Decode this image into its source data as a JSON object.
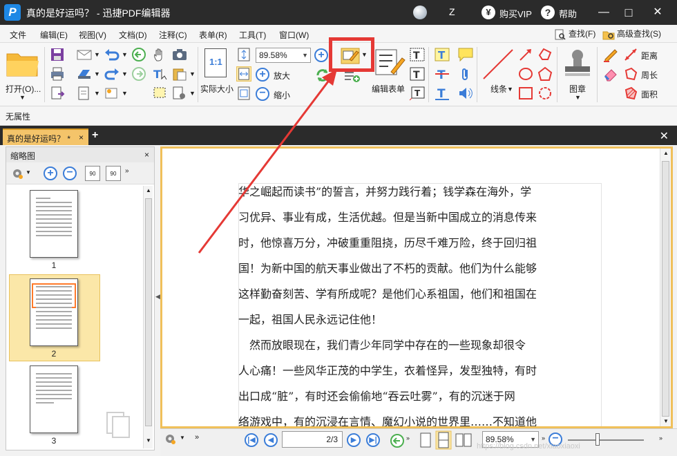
{
  "app": {
    "title": "真的是好运吗？ - 迅捷PDF编辑器",
    "logo_letter": "P",
    "user_label": "Z",
    "vip_icon": "yen-icon",
    "vip_label": "购买VIP",
    "help_label": "帮助",
    "minimize": "—",
    "maximize": "□",
    "close": "✕"
  },
  "menu": {
    "items": [
      "文件",
      "编辑(E)",
      "视图(V)",
      "文档(D)",
      "注释(C)",
      "表单(R)",
      "工具(T)",
      "窗口(W)"
    ],
    "find": "查找(F)",
    "advanced_find": "高级查找(S)"
  },
  "toolbar": {
    "open_label": "打开(O)...",
    "zoom_value": "89.58%",
    "actual_size_icon_text": "1:1",
    "actual_size_label": "实际大小",
    "zoom_in_label": "放大",
    "zoom_out_label": "缩小",
    "edit_form_label": "编辑表单",
    "line_label": "线条",
    "stamp_label": "图章",
    "distance_label": "距离",
    "perimeter_label": "周长",
    "area_label": "面积"
  },
  "properties": {
    "text": "无属性"
  },
  "tabs": {
    "active_tab": "真的是好运吗？ *",
    "close_tab": "×",
    "add_tab": "+",
    "close_all": "✕"
  },
  "thumbnails": {
    "title": "缩略图",
    "close": "×",
    "rotate_left_label": "90",
    "rotate_right_label": "90",
    "pages": [
      "1",
      "2",
      "3"
    ],
    "selected_page": "2"
  },
  "document": {
    "lines": [
      "华之崛起而读书”的誓言，并努力践行着；钱学森在海外，学",
      "习优异、事业有成，生活优越。但是当新中国成立的消息传来",
      "时，他惊喜万分，冲破重重阻挠，历尽千难万险，终于回归祖",
      "国！为新中国的航天事业做出了不朽的贡献。他们为什么能够",
      "这样勤奋刻苦、学有所成呢？是他们心系祖国，他们和祖国在",
      "一起，祖国人民永远记住他！",
      "　然而放眼现在，我们青少年同学中存在的一些现象却很令",
      "人心痛！一些风华正茂的中学生，衣着怪异，发型独特，有时",
      "出口成“脏”，有时还会偷偷地“吞云吐雾”，有的沉迷于网",
      "络游戏中，有的沉浸在言情、魔幻小说的世界里……不知道他"
    ]
  },
  "status": {
    "page_field": "2/3",
    "zoom_value": "89.58%"
  },
  "watermark": "https://blog.csdn.net/xiaoxiaoxi",
  "colors": {
    "titlebar": "#2b2b2b",
    "accent_blue": "#3b7dd8",
    "tab_active": "#f4c46a",
    "highlight_red": "#e53935"
  }
}
